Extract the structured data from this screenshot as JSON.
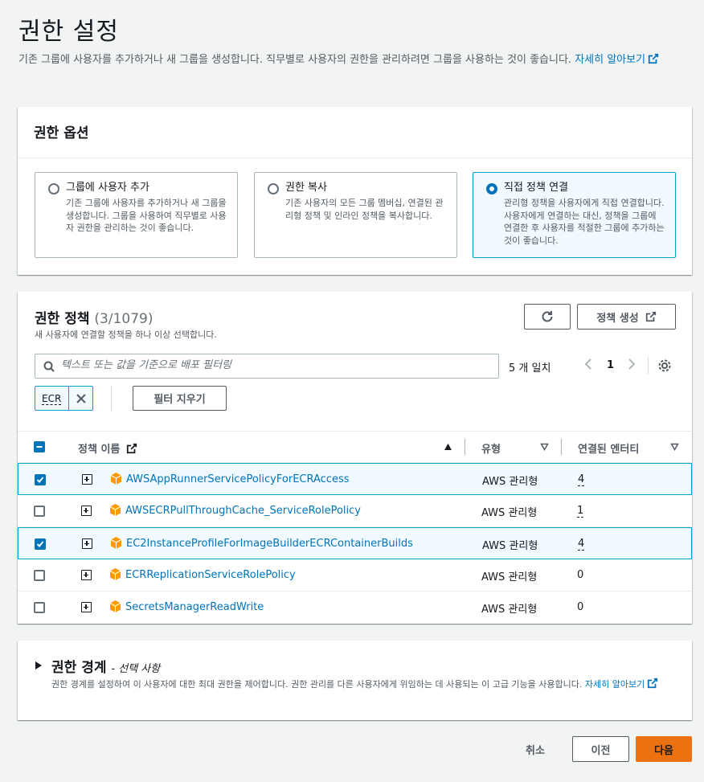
{
  "page": {
    "title": "권한 설정",
    "description": "기존 그룹에 사용자를 추가하거나 새 그룹을 생성합니다. 직무별로 사용자의 권한을 관리하려면 그룹을 사용하는 것이 좋습니다.",
    "learn_more": "자세히 알아보기"
  },
  "options_panel": {
    "title": "권한 옵션",
    "options": [
      {
        "title": "그룹에 사용자 추가",
        "desc": "기존 그룹에 사용자를 추가하거나 새 그룹을 생성합니다. 그룹을 사용하여 직무별로 사용자 권한을 관리하는 것이 좋습니다.",
        "selected": false
      },
      {
        "title": "권한 복사",
        "desc": "기존 사용자의 모든 그룹 멤버십, 연결된 관리형 정책 및 인라인 정책을 복사합니다.",
        "selected": false
      },
      {
        "title": "직접 정책 연결",
        "desc": "관리형 정책을 사용자에게 직접 연결합니다. 사용자에게 연결하는 대신, 정책을 그룹에 연결한 후 사용자를 적절한 그룹에 추가하는 것이 좋습니다.",
        "selected": true
      }
    ]
  },
  "policies_panel": {
    "title": "권한 정책",
    "count": "(3/1079)",
    "description": "새 사용자에 연결할 정책을 하나 이상 선택합니다.",
    "refresh_icon": "refresh-icon",
    "create_label": "정책 생성",
    "search_placeholder": "텍스트 또는 값을 기준으로 배포 필터링",
    "match_text": "5 개 일치",
    "page": "1",
    "filter_token": "ECR",
    "clear_filters_label": "필터 지우기",
    "columns": {
      "name": "정책 이름",
      "type": "유형",
      "entities": "연결된 엔터티"
    },
    "rows": [
      {
        "name": "AWSAppRunnerServicePolicyForECRAccess",
        "type": "AWS 관리형",
        "entities": "4",
        "checked": true
      },
      {
        "name": "AWSECRPullThroughCache_ServiceRolePolicy",
        "type": "AWS 관리형",
        "entities": "1",
        "checked": false
      },
      {
        "name": "EC2InstanceProfileForImageBuilderECRContainerBuilds",
        "type": "AWS 관리형",
        "entities": "4",
        "checked": true
      },
      {
        "name": "ECRReplicationServiceRolePolicy",
        "type": "AWS 관리형",
        "entities": "0",
        "checked": false
      },
      {
        "name": "SecretsManagerReadWrite",
        "type": "AWS 관리형",
        "entities": "0",
        "checked": false
      }
    ]
  },
  "boundary_panel": {
    "title": "권한 경계",
    "optional": "- 선택 사항",
    "description": "권한 경계를 설정하여 이 사용자에 대한 최대 권한을 제어합니다. 권한 관리를 다른 사용자에게 위임하는 데 사용되는 이 고급 기능을 사용합니다.",
    "learn_more": "자세히 알아보기"
  },
  "footer": {
    "cancel": "취소",
    "previous": "이전",
    "next": "다음"
  },
  "colors": {
    "accent": "#0073bb",
    "primary_button": "#ec7211",
    "selected_bg": "#f1faff",
    "selected_border": "#00a1c9"
  }
}
